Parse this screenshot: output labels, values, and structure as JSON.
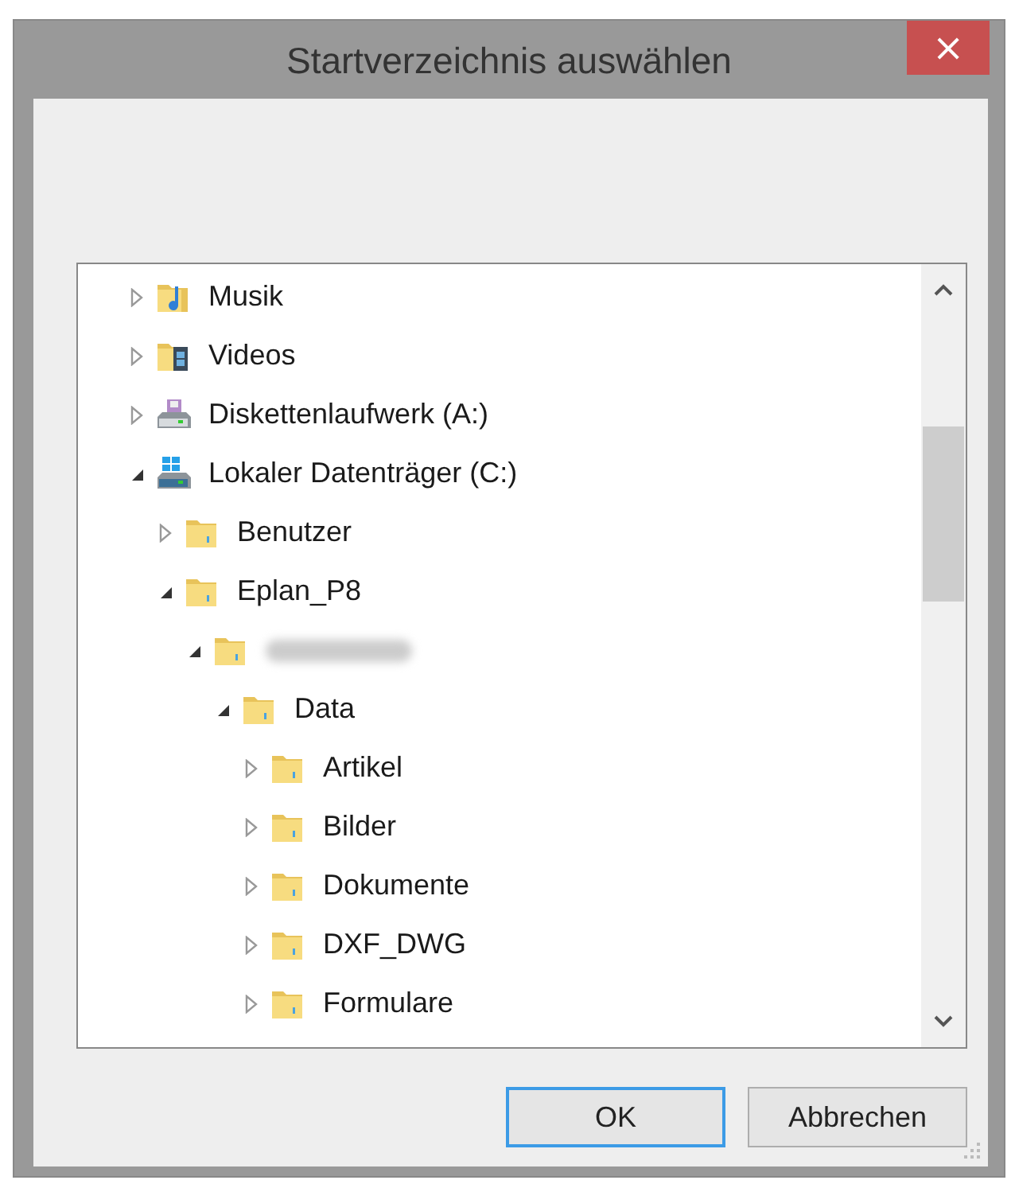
{
  "window": {
    "title": "Startverzeichnis auswählen",
    "close": "×"
  },
  "tree": [
    {
      "label": "Musik",
      "kind": "music",
      "expanded": false
    },
    {
      "label": "Videos",
      "kind": "video",
      "expanded": false
    },
    {
      "label": "Diskettenlaufwerk (A:)",
      "kind": "floppy",
      "expanded": false
    },
    {
      "label": "Lokaler Datenträger (C:)",
      "kind": "drive",
      "expanded": true,
      "children": [
        {
          "label": "Benutzer",
          "kind": "folder",
          "expanded": false
        },
        {
          "label": "Eplan_P8",
          "kind": "folder",
          "expanded": true,
          "children": [
            {
              "kind": "redacted",
              "expanded": true,
              "children": [
                {
                  "label": "Data",
                  "kind": "folder",
                  "expanded": true,
                  "children": [
                    {
                      "label": "Artikel",
                      "kind": "folder",
                      "expanded": false
                    },
                    {
                      "label": "Bilder",
                      "kind": "folder",
                      "expanded": false
                    },
                    {
                      "label": "Dokumente",
                      "kind": "folder",
                      "expanded": false
                    },
                    {
                      "label": "DXF_DWG",
                      "kind": "folder",
                      "expanded": false
                    },
                    {
                      "label": "Formulare",
                      "kind": "folder",
                      "expanded": false
                    }
                  ]
                }
              ]
            }
          ]
        }
      ]
    }
  ],
  "buttons": [
    {
      "label": "OK",
      "kind": "default"
    },
    {
      "label": "Abbrechen",
      "kind": "normal"
    }
  ]
}
